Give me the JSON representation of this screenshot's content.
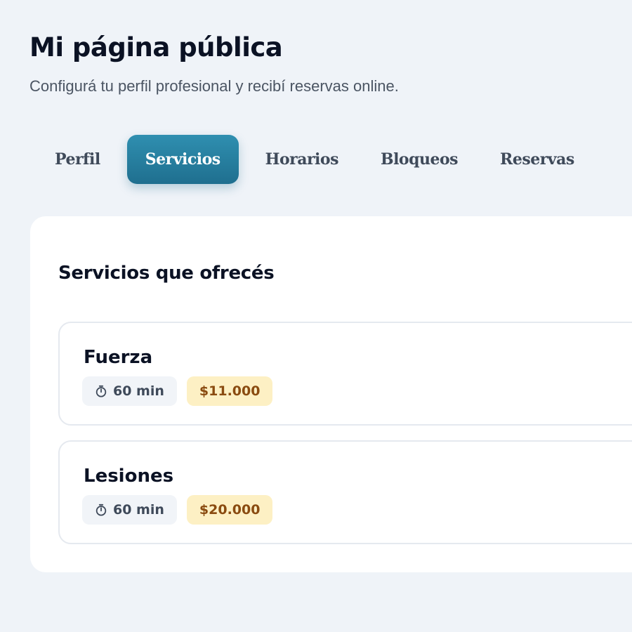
{
  "header": {
    "title": "Mi página pública",
    "subtitle": "Configurá tu perfil profesional y recibí reservas online."
  },
  "tabs": [
    {
      "label": "Perfil",
      "active": false
    },
    {
      "label": "Servicios",
      "active": true
    },
    {
      "label": "Horarios",
      "active": false
    },
    {
      "label": "Bloqueos",
      "active": false
    },
    {
      "label": "Reservas",
      "active": false
    }
  ],
  "services_section": {
    "title": "Servicios que ofrecés",
    "items": [
      {
        "name": "Fuerza",
        "duration": "60 min",
        "price": "$11.000"
      },
      {
        "name": "Lesiones",
        "duration": "60 min",
        "price": "$20.000"
      }
    ]
  },
  "colors": {
    "accent": "#1f6f8f",
    "price_bg": "#fdf0c4",
    "price_text": "#8a4b10",
    "background": "#eff3f8"
  },
  "icons": {
    "duration": "stopwatch-icon"
  }
}
